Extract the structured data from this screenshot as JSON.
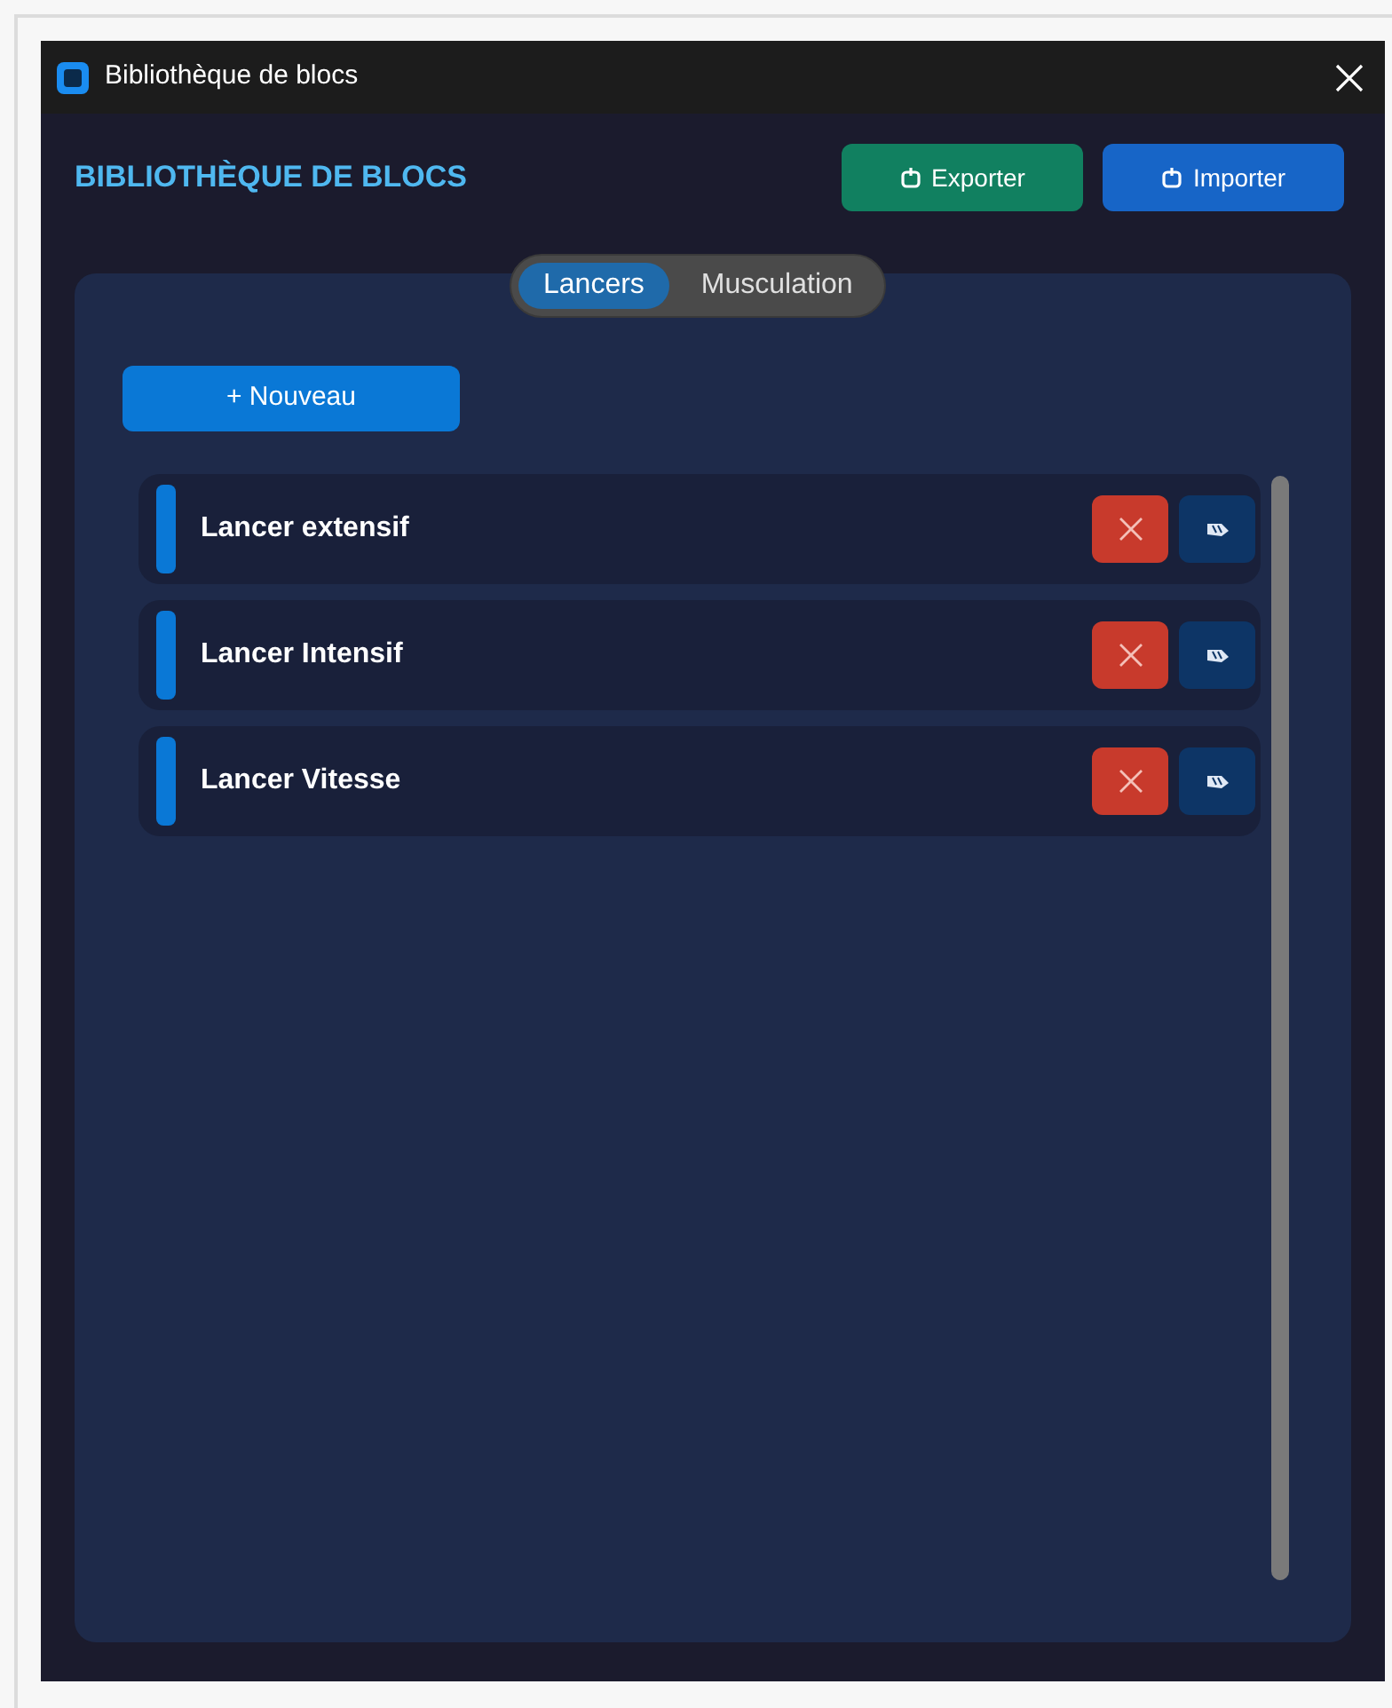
{
  "window": {
    "title": "Bibliothèque de blocs"
  },
  "header": {
    "title": "BIBLIOTHÈQUE DE BLOCS",
    "buttons": [
      {
        "label": "Exporter",
        "kind": "export"
      },
      {
        "label": "Importer",
        "kind": "import"
      }
    ]
  },
  "tabs": [
    {
      "label": "Lancers",
      "selected": true
    },
    {
      "label": "Musculation",
      "selected": false
    }
  ],
  "new_button": "+ Nouveau",
  "blocks": [
    {
      "name": "Lancer extensif",
      "color": "#0a78d6"
    },
    {
      "name": "Lancer Intensif",
      "color": "#0a78d6"
    },
    {
      "name": "Lancer Vitesse",
      "color": "#0a78d6"
    }
  ]
}
